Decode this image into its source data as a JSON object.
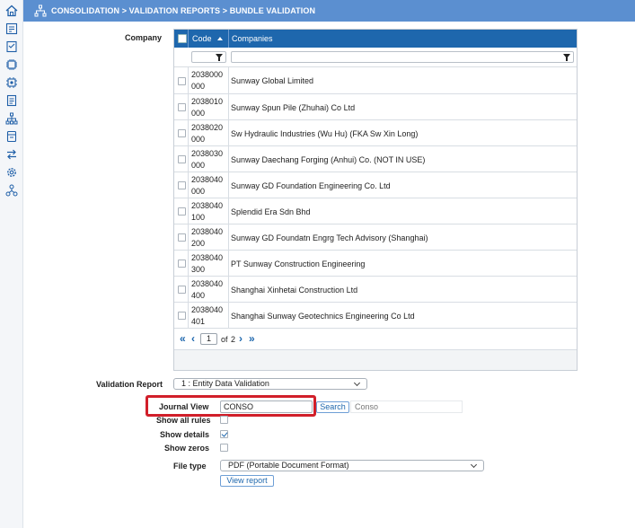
{
  "breadcrumb": "CONSOLIDATION > VALIDATION REPORTS > BUNDLE VALIDATION",
  "sidebar_icons": [
    "home-icon",
    "consolidation-icon",
    "checklist-icon",
    "chip-icon",
    "chip-settings-icon",
    "report-icon",
    "hierarchy-icon",
    "journal-icon",
    "transfer-icon",
    "settings-icon",
    "workflow-icon"
  ],
  "company": {
    "label": "Company",
    "columns": {
      "code": "Code",
      "companies": "Companies"
    },
    "rows": [
      {
        "code": "2038000 000",
        "code_l1": "2038000",
        "code_l2": "000",
        "name": "Sunway Global Limited"
      },
      {
        "code": "2038010 000",
        "code_l1": "2038010",
        "code_l2": "000",
        "name": "Sunway Spun Pile (Zhuhai) Co Ltd"
      },
      {
        "code": "2038020 000",
        "code_l1": "2038020",
        "code_l2": "000",
        "name": "Sw Hydraulic Industries (Wu Hu) (FKA Sw Xin Long)"
      },
      {
        "code": "2038030 000",
        "code_l1": "2038030",
        "code_l2": "000",
        "name": "Sunway Daechang Forging (Anhui) Co. (NOT IN USE)"
      },
      {
        "code": "2038040 000",
        "code_l1": "2038040",
        "code_l2": "000",
        "name": "Sunway GD Foundation Engineering Co. Ltd"
      },
      {
        "code": "2038040 100",
        "code_l1": "2038040",
        "code_l2": "100",
        "name": "Splendid Era Sdn Bhd"
      },
      {
        "code": "2038040 200",
        "code_l1": "2038040",
        "code_l2": "200",
        "name": "Sunway GD Foundatn Engrg Tech Advisory (Shanghai)"
      },
      {
        "code": "2038040 300",
        "code_l1": "2038040",
        "code_l2": "300",
        "name": "PT Sunway Construction Engineering"
      },
      {
        "code": "2038040 400",
        "code_l1": "2038040",
        "code_l2": "400",
        "name": "Shanghai Xinhetai Construction Ltd"
      },
      {
        "code": "2038040 401",
        "code_l1": "2038040",
        "code_l2": "401",
        "name": "Shanghai Sunway Geotechnics Engineering Co Ltd"
      }
    ],
    "pager": {
      "current_page": "1",
      "of_label": "of",
      "total_pages": "2"
    }
  },
  "validation_report": {
    "label": "Validation Report",
    "value": "1 : Entity Data Validation"
  },
  "journal_view": {
    "label": "Journal View",
    "value": "CONSO",
    "search_label": "Search",
    "result": "Conso"
  },
  "options": {
    "show_all_rules": {
      "label": "Show all rules",
      "checked": false
    },
    "show_details": {
      "label": "Show details",
      "checked": true
    },
    "show_zeros": {
      "label": "Show zeros",
      "checked": false
    }
  },
  "file_type": {
    "label": "File type",
    "value": "PDF (Portable Document Format)"
  },
  "view_report_label": "View report",
  "colors": {
    "accent": "#1e67ad",
    "topbar": "#5b8fd0",
    "highlight": "#d11f2a"
  }
}
